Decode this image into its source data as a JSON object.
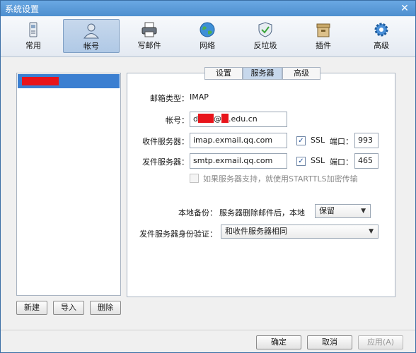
{
  "window": {
    "title": "系统设置",
    "close": "✕"
  },
  "toolbar": {
    "items": [
      {
        "label": "常用",
        "icon": "phone-settings-icon"
      },
      {
        "label": "帐号",
        "icon": "user-account-icon",
        "active": true
      },
      {
        "label": "写邮件",
        "icon": "printer-compose-icon"
      },
      {
        "label": "网络",
        "icon": "globe-icon"
      },
      {
        "label": "反垃圾",
        "icon": "shield-icon"
      },
      {
        "label": "插件",
        "icon": "box-plugin-icon"
      },
      {
        "label": "高级",
        "icon": "gear-icon"
      }
    ]
  },
  "sidebar": {
    "buttons": {
      "new": "新建",
      "import": "导入",
      "delete": "删除"
    }
  },
  "tabs": {
    "settings": "设置",
    "server": "服务器",
    "advanced": "高级"
  },
  "form": {
    "mailbox_type_label": "邮箱类型：",
    "mailbox_type_value": "IMAP",
    "account_label": "帐号：",
    "account_prefix": "d",
    "account_mid": "@",
    "account_suffix": ".edu.cn",
    "incoming_label": "收件服务器：",
    "incoming_value": "imap.exmail.qq.com",
    "outgoing_label": "发件服务器：",
    "outgoing_value": "smtp.exmail.qq.com",
    "ssl_label": "SSL",
    "port_label": "端口：",
    "incoming_port": "993",
    "outgoing_port": "465",
    "checkmark": "✓",
    "starttls_label": "如果服务器支持，就使用STARTTLS加密传输",
    "backup_label": "本地备份：",
    "backup_desc": "服务器删除邮件后，本地",
    "backup_value": "保留",
    "auth_label": "发件服务器身份验证：",
    "auth_value": "和收件服务器相同",
    "arrow": "▼"
  },
  "footer": {
    "ok": "确定",
    "cancel": "取消",
    "apply": "应用(A)"
  },
  "colors": {
    "accent": "#3b7fd1",
    "redaction": "#e8141b",
    "titlebar": "#4e8fcf"
  }
}
